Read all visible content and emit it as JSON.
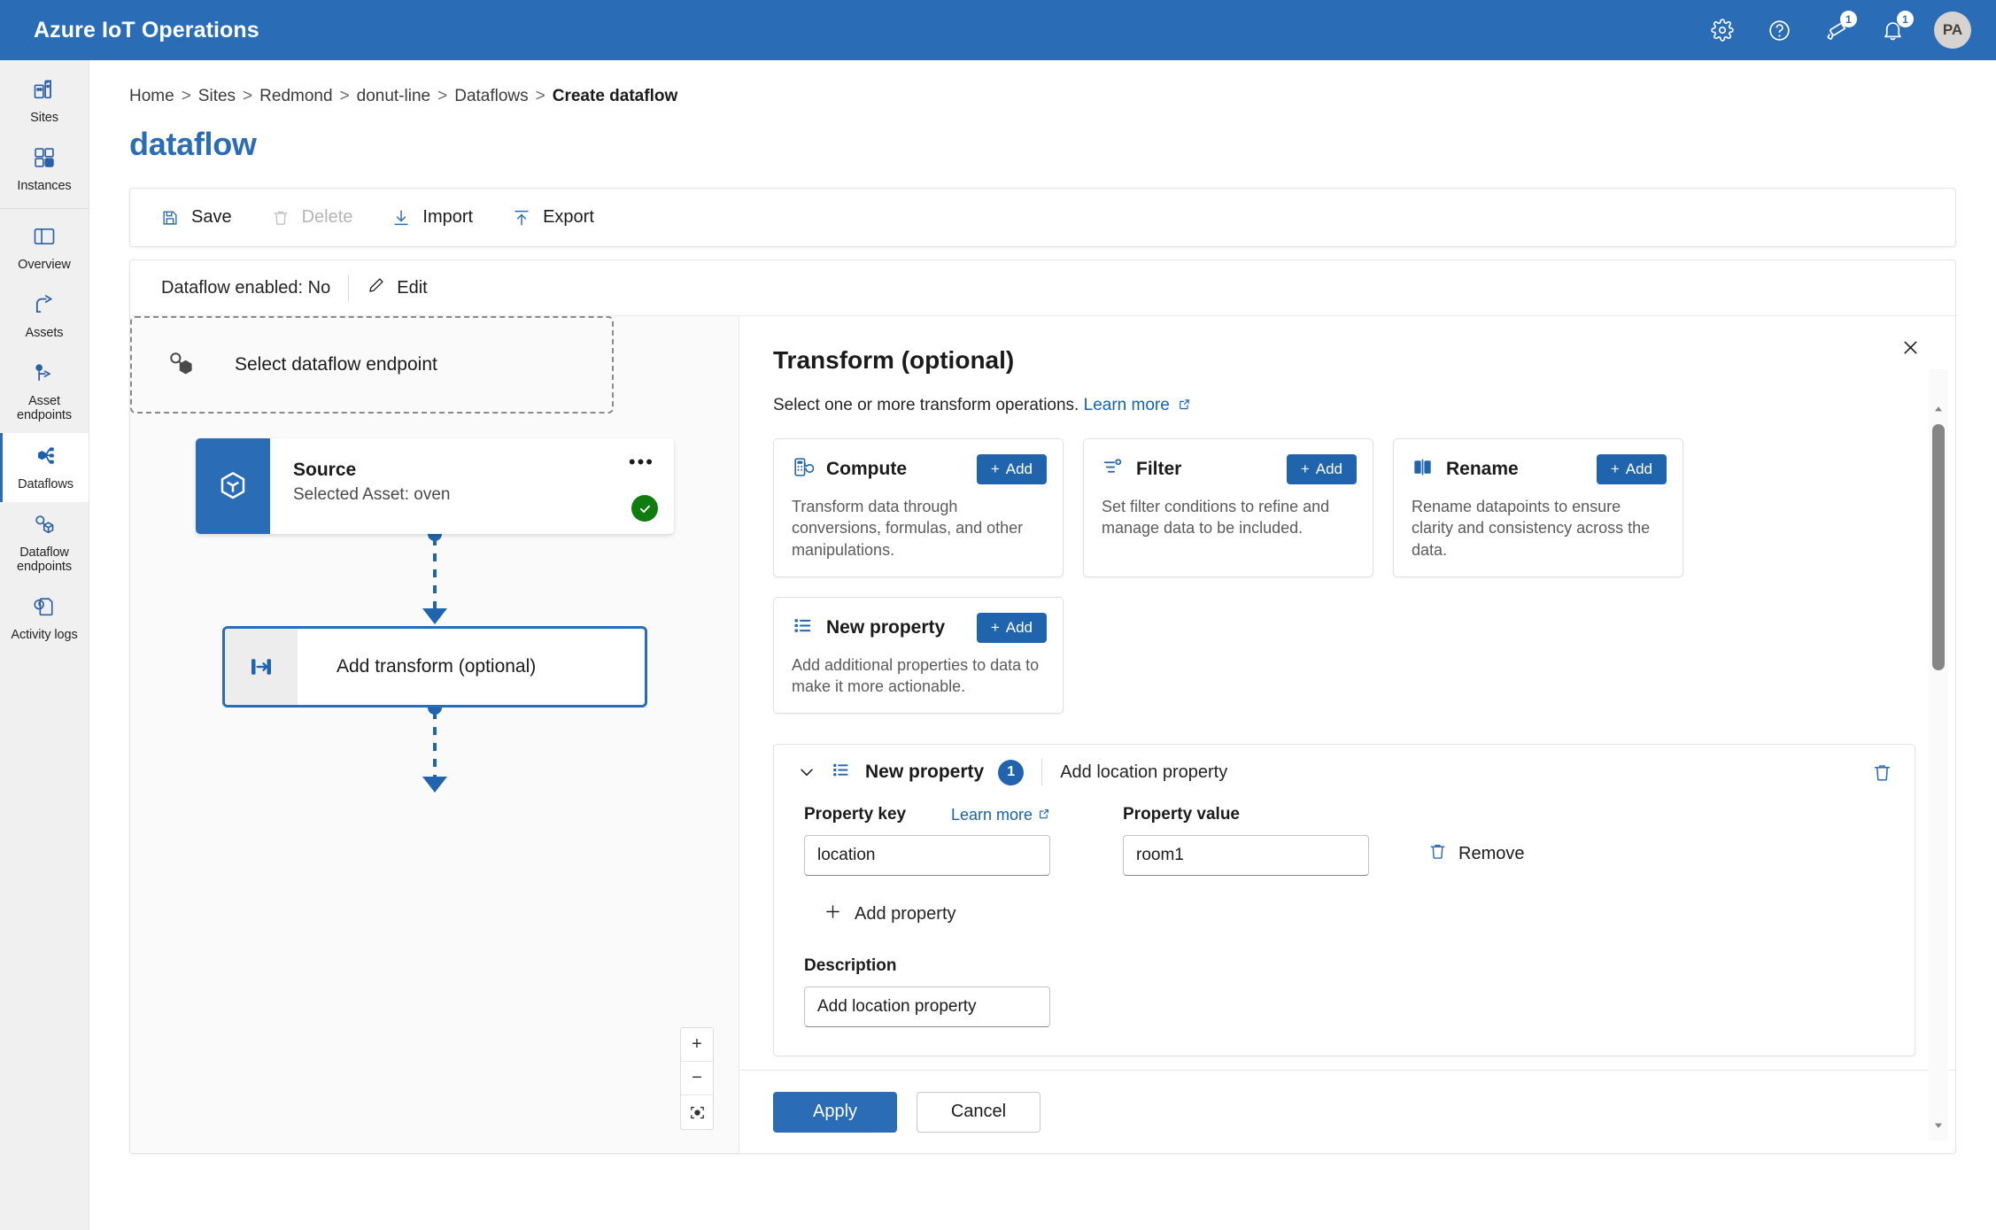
{
  "app": {
    "brand": "Azure IoT Operations",
    "avatar_initials": "PA",
    "icons": {
      "settings": "gear-icon",
      "help": "help-icon",
      "announcements": "megaphone-icon",
      "notifications": "bell-icon"
    },
    "announcements_count": "1",
    "notifications_count": "1"
  },
  "sidebar": {
    "items": [
      {
        "label": "Sites",
        "icon": "sites-icon"
      },
      {
        "label": "Instances",
        "icon": "instances-icon"
      },
      {
        "label": "Overview",
        "icon": "overview-icon"
      },
      {
        "label": "Assets",
        "icon": "assets-icon"
      },
      {
        "label": "Asset endpoints",
        "icon": "asset-endpoints-icon"
      },
      {
        "label": "Dataflows",
        "icon": "dataflows-icon"
      },
      {
        "label": "Dataflow endpoints",
        "icon": "dataflow-endpoints-icon"
      },
      {
        "label": "Activity logs",
        "icon": "activity-logs-icon"
      }
    ],
    "selected": "Dataflows"
  },
  "breadcrumb": {
    "items": [
      "Home",
      "Sites",
      "Redmond",
      "donut-line",
      "Dataflows"
    ],
    "current": "Create dataflow",
    "separator": ">"
  },
  "page": {
    "title": "dataflow"
  },
  "toolbar": {
    "save": "Save",
    "delete": "Delete",
    "delete_disabled": true,
    "import": "Import",
    "export": "Export"
  },
  "status_bar": {
    "enabled_label": "Dataflow enabled: No",
    "edit": "Edit"
  },
  "canvas": {
    "source": {
      "title": "Source",
      "subtitle": "Selected Asset: oven",
      "menu": "•••",
      "status": "valid"
    },
    "transform": {
      "label": "Add transform (optional)"
    },
    "endpoint": {
      "label": "Select dataflow endpoint"
    },
    "zoom_controls": {
      "zoom_in": "+",
      "zoom_out": "−",
      "fit": "fit-to-view"
    }
  },
  "panel": {
    "title": "Transform (optional)",
    "subtitle": "Select one or more transform operations.",
    "learn_more": "Learn more",
    "close": "close-icon",
    "operations": [
      {
        "name": "Compute",
        "icon": "compute-icon",
        "add_label": "Add",
        "description": "Transform data through conversions, formulas, and other manipulations."
      },
      {
        "name": "Filter",
        "icon": "filter-icon",
        "add_label": "Add",
        "description": "Set filter conditions to refine and manage data to be included."
      },
      {
        "name": "Rename",
        "icon": "rename-icon",
        "add_label": "Add",
        "description": "Rename datapoints to ensure clarity and consistency across the data."
      },
      {
        "name": "New property",
        "icon": "new-property-icon",
        "add_label": "Add",
        "description": "Add additional properties to data to make it more actionable."
      }
    ],
    "section": {
      "title": "New property",
      "count": "1",
      "note": "Add location property",
      "property_key_label": "Property key",
      "property_key_learn_more": "Learn more",
      "property_key_value": "location",
      "property_value_label": "Property value",
      "property_value_value": "room1",
      "remove_label": "Remove",
      "add_property_label": "Add property",
      "description_label": "Description",
      "description_value": "Add location property"
    },
    "footer": {
      "apply": "Apply",
      "cancel": "Cancel"
    }
  },
  "colors": {
    "brand_blue": "#2b6cb6",
    "accent_blue": "#1f64ad",
    "link_blue": "#1462b0",
    "success_green": "#107c10"
  }
}
